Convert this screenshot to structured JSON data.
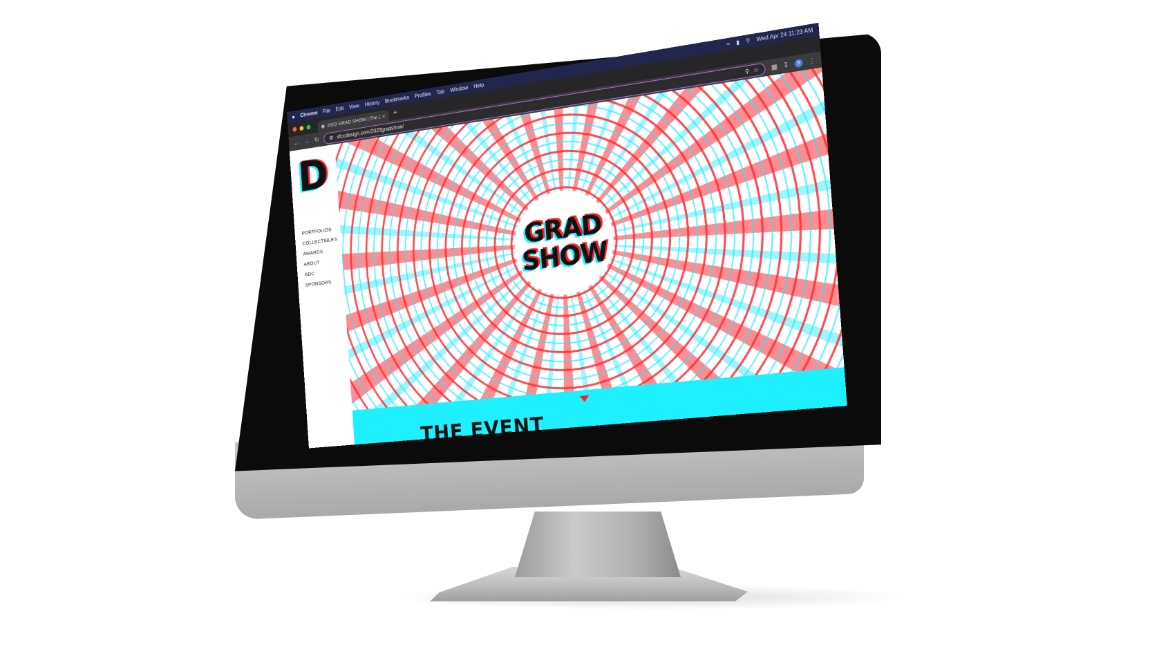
{
  "menubar": {
    "apple_icon": "apple-icon",
    "app": "Chrome",
    "menus": [
      "File",
      "Edit",
      "View",
      "History",
      "Bookmarks",
      "Profiles",
      "Tab",
      "Window",
      "Help"
    ],
    "clock": "Wed Apr 24  11:23 AM"
  },
  "browser": {
    "tab_title": "2023 GRAD SHOW | The 20...",
    "url": "sfccdesign.com/2023gradshow/",
    "avatar_letter": "S"
  },
  "site": {
    "logo_letter": "D",
    "nav": [
      "PORTFOLIOS",
      "COLLECTIBLES",
      "AWARDS",
      "ABOUT",
      "GDC",
      "SPONSORS"
    ],
    "hero_line1": "GRAD",
    "hero_line2": "SHOW",
    "section_title": "THE EVENT"
  },
  "colors": {
    "accent_cyan": "#1ff0ff",
    "accent_red": "#ff1f2b",
    "menubar": "#22264e"
  }
}
